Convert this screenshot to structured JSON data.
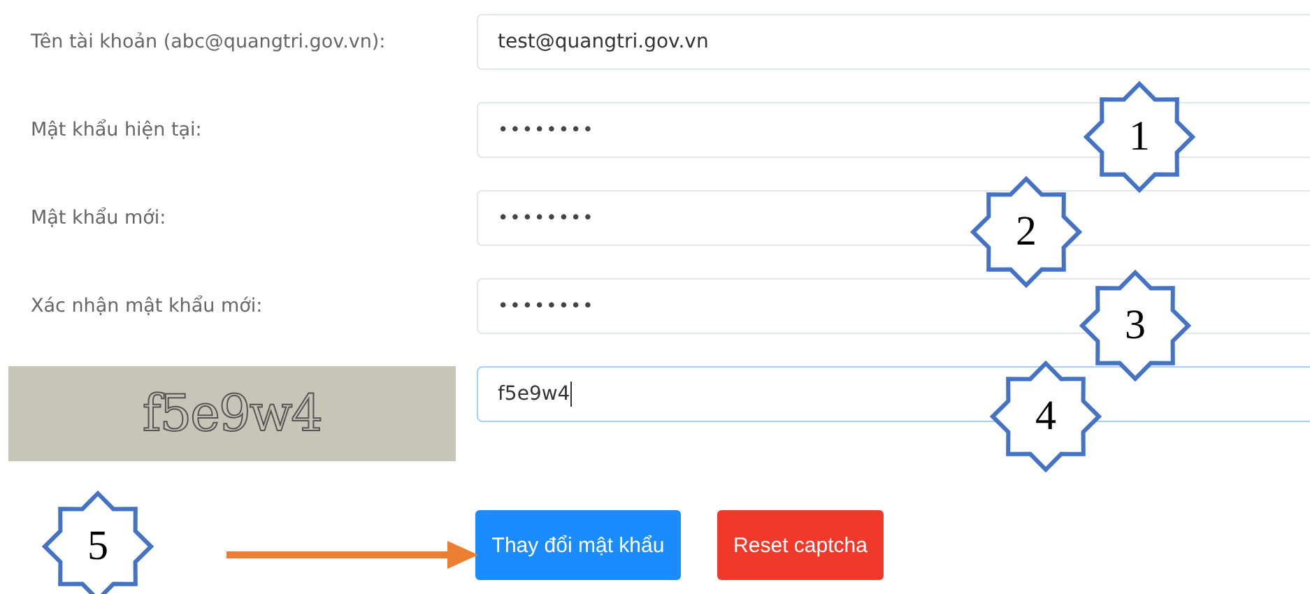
{
  "fields": [
    {
      "label": "Tên tài khoản (abc@quangtri.gov.vn):",
      "value": "test@quangtri.gov.vn",
      "kind": "text"
    },
    {
      "label": "Mật khẩu hiện tại:",
      "value": "••••••••",
      "kind": "password"
    },
    {
      "label": "Mật khẩu mới:",
      "value": "••••••••",
      "kind": "password"
    },
    {
      "label": "Xác nhận mật khẩu mới:",
      "value": "••••••••",
      "kind": "password"
    }
  ],
  "captcha": {
    "code": "f5e9w4",
    "value": "f5e9w4",
    "focused": true
  },
  "buttons": [
    {
      "label": "Thay đổi mật khẩu",
      "kind": "primary"
    },
    {
      "label": "Reset captcha",
      "kind": "danger"
    }
  ],
  "callouts": [
    {
      "number": "1"
    },
    {
      "number": "2"
    },
    {
      "number": "3"
    },
    {
      "number": "4"
    },
    {
      "number": "5"
    }
  ]
}
